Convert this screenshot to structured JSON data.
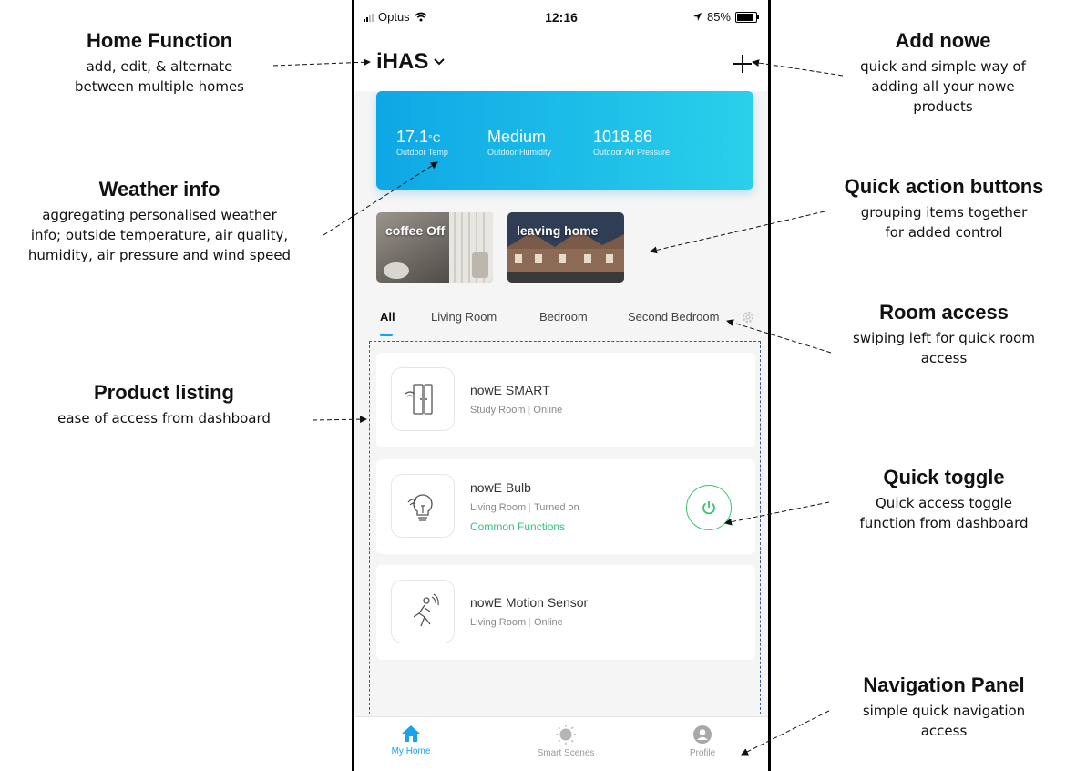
{
  "status_bar": {
    "carrier": "Optus",
    "time": "12:16",
    "battery": "85%"
  },
  "header": {
    "home_name": "iHAS"
  },
  "weather": {
    "temp_value": "17.1",
    "temp_unit": "°C",
    "temp_label": "Outdoor Temp",
    "humidity_value": "Medium",
    "humidity_label": "Outdoor Humidity",
    "pressure_value": "1018.86",
    "pressure_label": "Outdoor Air Pressure"
  },
  "scenes": [
    {
      "label": "coffee Off"
    },
    {
      "label": "leaving home"
    }
  ],
  "tabs": [
    {
      "label": "All",
      "active": true
    },
    {
      "label": "Living Room"
    },
    {
      "label": "Bedroom"
    },
    {
      "label": "Second Bedroom"
    }
  ],
  "devices": [
    {
      "name": "nowE SMART",
      "room": "Study Room",
      "status": "Online",
      "icon": "door-sensor-icon"
    },
    {
      "name": "nowE Bulb",
      "room": "Living Room",
      "status": "Turned on",
      "functions_link": "Common Functions",
      "icon": "bulb-icon"
    },
    {
      "name": "nowE Motion Sensor",
      "room": "Living Room",
      "status": "Online",
      "icon": "motion-sensor-icon"
    }
  ],
  "nav": [
    {
      "label": "My Home",
      "icon": "home-icon",
      "active": true
    },
    {
      "label": "Smart Scenes",
      "icon": "sun-icon"
    },
    {
      "label": "Profile",
      "icon": "profile-icon"
    }
  ],
  "annotations": {
    "home_function": {
      "title": "Home Function",
      "line1": "add, edit, & alternate",
      "line2": "between multiple homes"
    },
    "weather_info": {
      "title": "Weather info",
      "line1": "aggregating personalised weather",
      "line2": "info; outside temperature, air quality,",
      "line3": "humidity, air pressure and wind speed"
    },
    "product_listing": {
      "title": "Product listing",
      "line1": "ease of access from dashboard"
    },
    "add_nowe": {
      "title": "Add nowe",
      "line1": "quick and simple way of",
      "line2": "adding all your nowe",
      "line3": "products"
    },
    "quick_action": {
      "title": "Quick action buttons",
      "line1": "grouping items together",
      "line2": "for added control"
    },
    "room_access": {
      "title": "Room access",
      "line1": "swiping left for quick room",
      "line2": "access"
    },
    "quick_toggle": {
      "title": "Quick toggle",
      "line1": "Quick access toggle",
      "line2": "function from dashboard"
    },
    "navigation_panel": {
      "title": "Navigation Panel",
      "line1": "simple quick navigation",
      "line2": "access"
    }
  },
  "colors": {
    "accent": "#1aa3e8",
    "weather_start": "#0ea7e6",
    "weather_end": "#2ad0ea",
    "power_green": "#37c46d",
    "link_green": "#30c47f"
  }
}
